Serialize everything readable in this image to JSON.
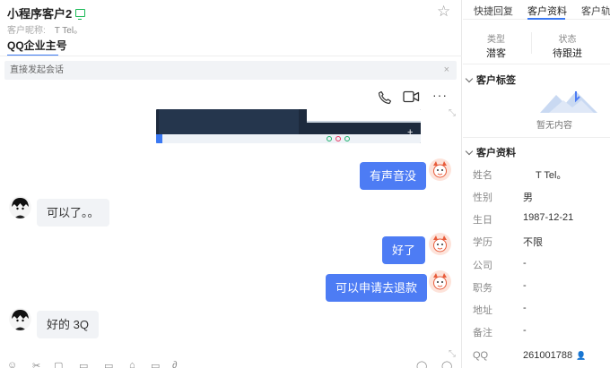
{
  "header": {
    "customer_name": "小程序客户2",
    "nickname_label": "客户昵称:",
    "nickname_value": "T Tel。",
    "account_tab": "QQ企业主号"
  },
  "banner": {
    "text": "直接发起会话",
    "close": "×"
  },
  "toolbar": {
    "more": "···"
  },
  "messages": [
    {
      "side": "out",
      "text": "有声音没"
    },
    {
      "side": "in",
      "text": "可以了。。"
    },
    {
      "side": "out",
      "text": "好了"
    },
    {
      "side": "out",
      "text": "可以申请去退款"
    },
    {
      "side": "in",
      "text": "好的   3Q"
    }
  ],
  "side_panel": {
    "tabs": [
      "快捷回复",
      "客户资料",
      "客户轨迹"
    ],
    "active_tab": "客户资料",
    "type_label": "类型",
    "type_value": "潜客",
    "status_label": "状态",
    "status_value": "待跟进",
    "tags_title": "客户标签",
    "tags_empty": "暂无内容",
    "profile_title": "客户资料",
    "profile_rows": [
      {
        "key": "姓名",
        "value": "T Tel。"
      },
      {
        "key": "性别",
        "value": "男"
      },
      {
        "key": "生日",
        "value": "1987-12-21"
      },
      {
        "key": "学历",
        "value": "不限"
      },
      {
        "key": "公司",
        "value": "-"
      },
      {
        "key": "职务",
        "value": "-"
      },
      {
        "key": "地址",
        "value": "-"
      },
      {
        "key": "备注",
        "value": "-"
      },
      {
        "key": "QQ",
        "value": "261001788"
      }
    ]
  },
  "colors": {
    "accent": "#3a78f2",
    "out_bubble": "#4d7cf4",
    "in_bubble": "#f1f3f6",
    "online": "#19b955"
  }
}
